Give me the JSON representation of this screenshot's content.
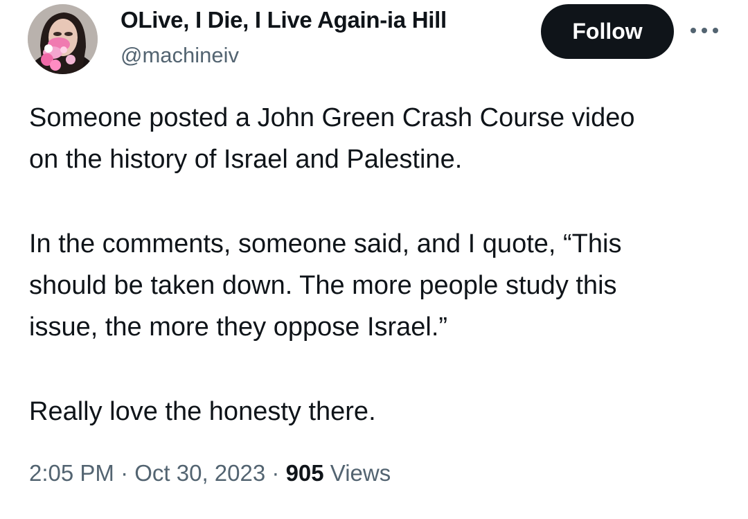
{
  "author": {
    "display_name": "OLive, I Die, I Live Again-ia Hill",
    "handle": "@machineiv"
  },
  "actions": {
    "follow_label": "Follow",
    "more_icon": "more-horizontal-icon"
  },
  "tweet": {
    "lines": [
      "Someone posted a John Green Crash Course video",
      "on the history of Israel and Palestine.",
      "In the comments, someone said, and I quote, “This",
      "should be taken down. The more people study this",
      "issue, the more they oppose Israel.”",
      "Really love the honesty there."
    ]
  },
  "meta": {
    "time": "2:05 PM",
    "separator": "·",
    "date": "Oct 30, 2023",
    "views_count": "905",
    "views_label": "Views"
  },
  "colors": {
    "text_primary": "#0f1419",
    "text_secondary": "#536471",
    "button_bg": "#0f1419",
    "button_text": "#ffffff"
  }
}
